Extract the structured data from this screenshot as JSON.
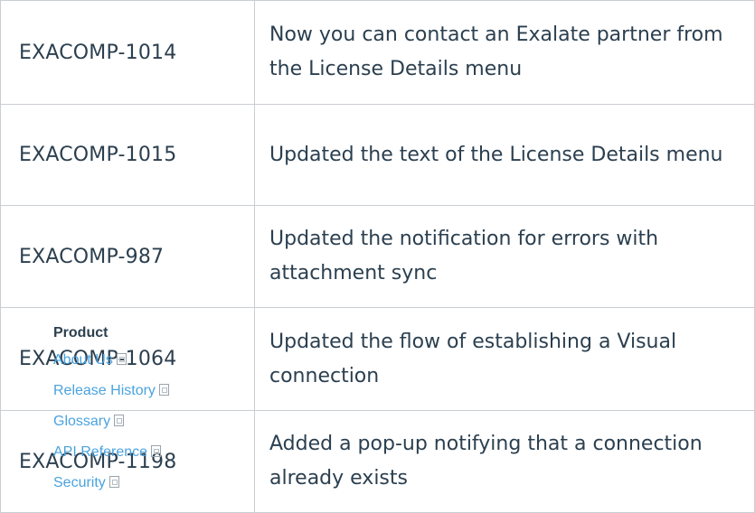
{
  "table": {
    "rows": [
      {
        "key": "EXACOMP-1014",
        "description": "Now you can contact an Exalate partner from the License Details menu"
      },
      {
        "key": "EXACOMP-1015",
        "description": "Updated the text of the License Details menu"
      },
      {
        "key": "EXACOMP-987",
        "description": "Updated the notification for errors with attachment sync"
      },
      {
        "key": "EXACOMP-1064",
        "description": "Updated the flow of establishing a Visual connection"
      },
      {
        "key": "EXACOMP-1198",
        "description": "Added a pop-up notifying that a connection already exists"
      }
    ]
  },
  "footer": {
    "heading": "Product",
    "links": [
      {
        "label": "About Us",
        "icon": "external-link-icon"
      },
      {
        "label": "Release History",
        "icon": "external-link-icon"
      },
      {
        "label": "Glossary",
        "icon": "external-link-icon"
      },
      {
        "label": "API Reference",
        "icon": "external-link-icon"
      },
      {
        "label": "Security",
        "icon": "external-link-icon"
      }
    ],
    "link_color": "#4aa3df"
  }
}
